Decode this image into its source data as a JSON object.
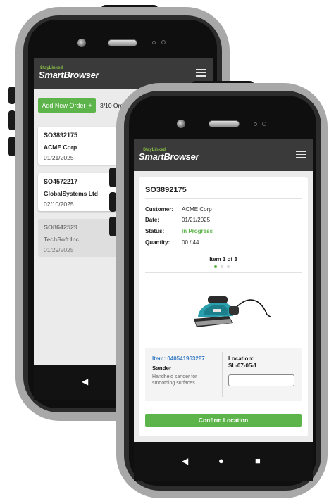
{
  "brand": {
    "tagline": "StayLinked",
    "name": "SmartBrowser"
  },
  "order_list": {
    "add_button_label": "Add New Order",
    "add_button_icon": "+",
    "order_count": "3/10 Orders",
    "orders": [
      {
        "id": "SO3892175",
        "company": "ACME Corp",
        "date": "01/21/2025"
      },
      {
        "id": "SO4572217",
        "company": "GlobalSystems Ltd",
        "date": "02/10/2025"
      },
      {
        "id": "SO8642529",
        "company": "TechSoft Inc",
        "date": "01/29/2025"
      }
    ]
  },
  "order_detail": {
    "order_id": "SO3892175",
    "fields": [
      {
        "label": "Customer:",
        "value": "ACME Corp"
      },
      {
        "label": "Date:",
        "value": "01/21/2025"
      },
      {
        "label": "Status:",
        "value": "In Progress"
      },
      {
        "label": "Quantity:",
        "value": "00 / 44"
      }
    ],
    "pager": {
      "text": "Item 1 of 3",
      "current": 1,
      "total": 3
    },
    "item": {
      "number": "Item: 040541963287",
      "name": "Sander",
      "description": "Handheld sander for smoothing surfaces.",
      "location_label": "Location:",
      "location_value": "SL-07-05-1",
      "location_input_value": ""
    },
    "confirm_label": "Confirm Location"
  },
  "nav": {
    "back": "◀",
    "home": "●",
    "recent": "■"
  },
  "colors": {
    "accent": "#5db44a",
    "appbar": "#3a3a3a",
    "link": "#3b7dc4"
  }
}
